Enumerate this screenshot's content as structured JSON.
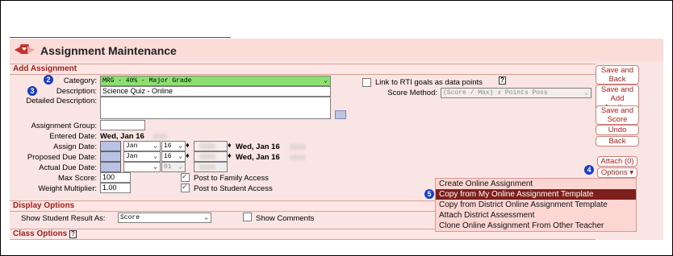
{
  "header": {
    "title": "Assignment Maintenance"
  },
  "sections": {
    "add_assignment": "Add Assignment",
    "display_options": "Display Options",
    "class_options": "Class Options"
  },
  "form": {
    "category_label": "Category:",
    "category_value": "MRG  -  40% - Major Grade",
    "description_label": "Description:",
    "description_value": "Science Quiz - Online",
    "detailed_description_label": "Detailed Description:",
    "assignment_group_label": "Assignment Group:",
    "entered_date_label": "Entered Date:",
    "entered_date_value": "Wed, Jan 16",
    "assign_date_label": "Assign Date:",
    "proposed_due_date_label": "Proposed Due Date:",
    "actual_due_date_label": "Actual Due Date:",
    "month_value": "Jan",
    "assign_day": "16",
    "due_day": "16",
    "actual_day": "01",
    "assign_date_text": "Wed, Jan 16",
    "due_date_text": "Wed, Jan 16",
    "max_score_label": "Max Score:",
    "max_score_value": "100",
    "weight_multiplier_label": "Weight Multiplier:",
    "weight_multiplier_value": "1.00",
    "post_family": "Post to Family Access",
    "post_student": "Post to Student Access",
    "link_rti": "Link to RTI goals as data points",
    "score_method_label": "Score Method:",
    "score_method_value": "(Score / Max) x Points Poss",
    "help_mark": "?"
  },
  "display": {
    "show_result_label": "Show Student Result As:",
    "show_result_value": "Score",
    "show_comments": "Show Comments"
  },
  "buttons": {
    "save_back": "Save and Back",
    "save_add": "Save and Add Another",
    "save_score": "Save and Score",
    "undo": "Undo",
    "back": "Back",
    "attach": "Attach (0)",
    "options": "Options ▾"
  },
  "menu": {
    "items": [
      "Create Online Assignment",
      "Copy from My Online Assignment Template",
      "Copy from District Online Assignment Template",
      "Attach District Assessment",
      "Clone Online Assignment From Other Teacher"
    ]
  },
  "badges": [
    "2",
    "3",
    "4",
    "5"
  ],
  "colors": {
    "accent": "#9c1d18",
    "category_fill": "#8be16f",
    "badge": "#1a3ec6",
    "menu_active": "#7d1f1b"
  }
}
